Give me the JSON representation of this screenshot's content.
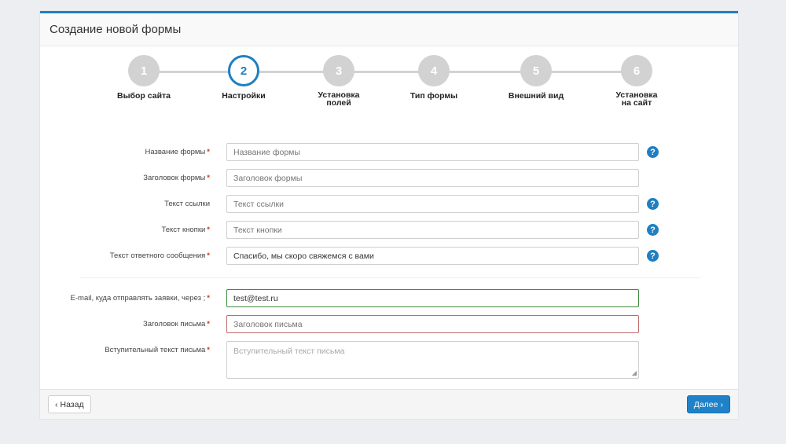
{
  "header": {
    "title": "Создание новой формы"
  },
  "wizard": {
    "steps": [
      {
        "number": "1",
        "label": "Выбор сайта"
      },
      {
        "number": "2",
        "label": "Настройки"
      },
      {
        "number": "3",
        "label": "Установка полей"
      },
      {
        "number": "4",
        "label": "Тип формы"
      },
      {
        "number": "5",
        "label": "Внешний вид"
      },
      {
        "number": "6",
        "label": "Установка на сайт"
      }
    ],
    "active_step": 2
  },
  "form": {
    "fields": [
      {
        "label": "Название формы",
        "required": "*",
        "value": "",
        "placeholder": "Название формы",
        "help": "?"
      },
      {
        "label": "Заголовок формы",
        "required": "*",
        "value": "",
        "placeholder": "Заголовок формы"
      },
      {
        "label": "Текст ссылки",
        "value": "",
        "placeholder": "Текст ссылки",
        "help": "?"
      },
      {
        "label": "Текст кнопки",
        "required": "*",
        "value": "",
        "placeholder": "Текст кнопки",
        "help": "?"
      },
      {
        "label": "Текст ответного сообщения",
        "required": "*",
        "value": "Спасибо, мы скоро свяжемся с вами",
        "placeholder": "",
        "help": "?"
      },
      {
        "label": "E-mail, куда отправлять заявки, через ;",
        "required": "*",
        "value": "test@test.ru",
        "placeholder": ""
      },
      {
        "label": "Заголовок письма",
        "required": "*",
        "value": "",
        "placeholder": "Заголовок письма"
      },
      {
        "label": "Вступительный текст письма",
        "required": "*",
        "value": "",
        "placeholder": "Вступительный текст письма"
      }
    ]
  },
  "footer": {
    "back_label": "Назад",
    "next_label": "Далее"
  },
  "colors": {
    "accent": "#1f7fc1",
    "valid": "#3e8a3e",
    "invalid": "#c26a6a",
    "required": "#c0392b"
  }
}
